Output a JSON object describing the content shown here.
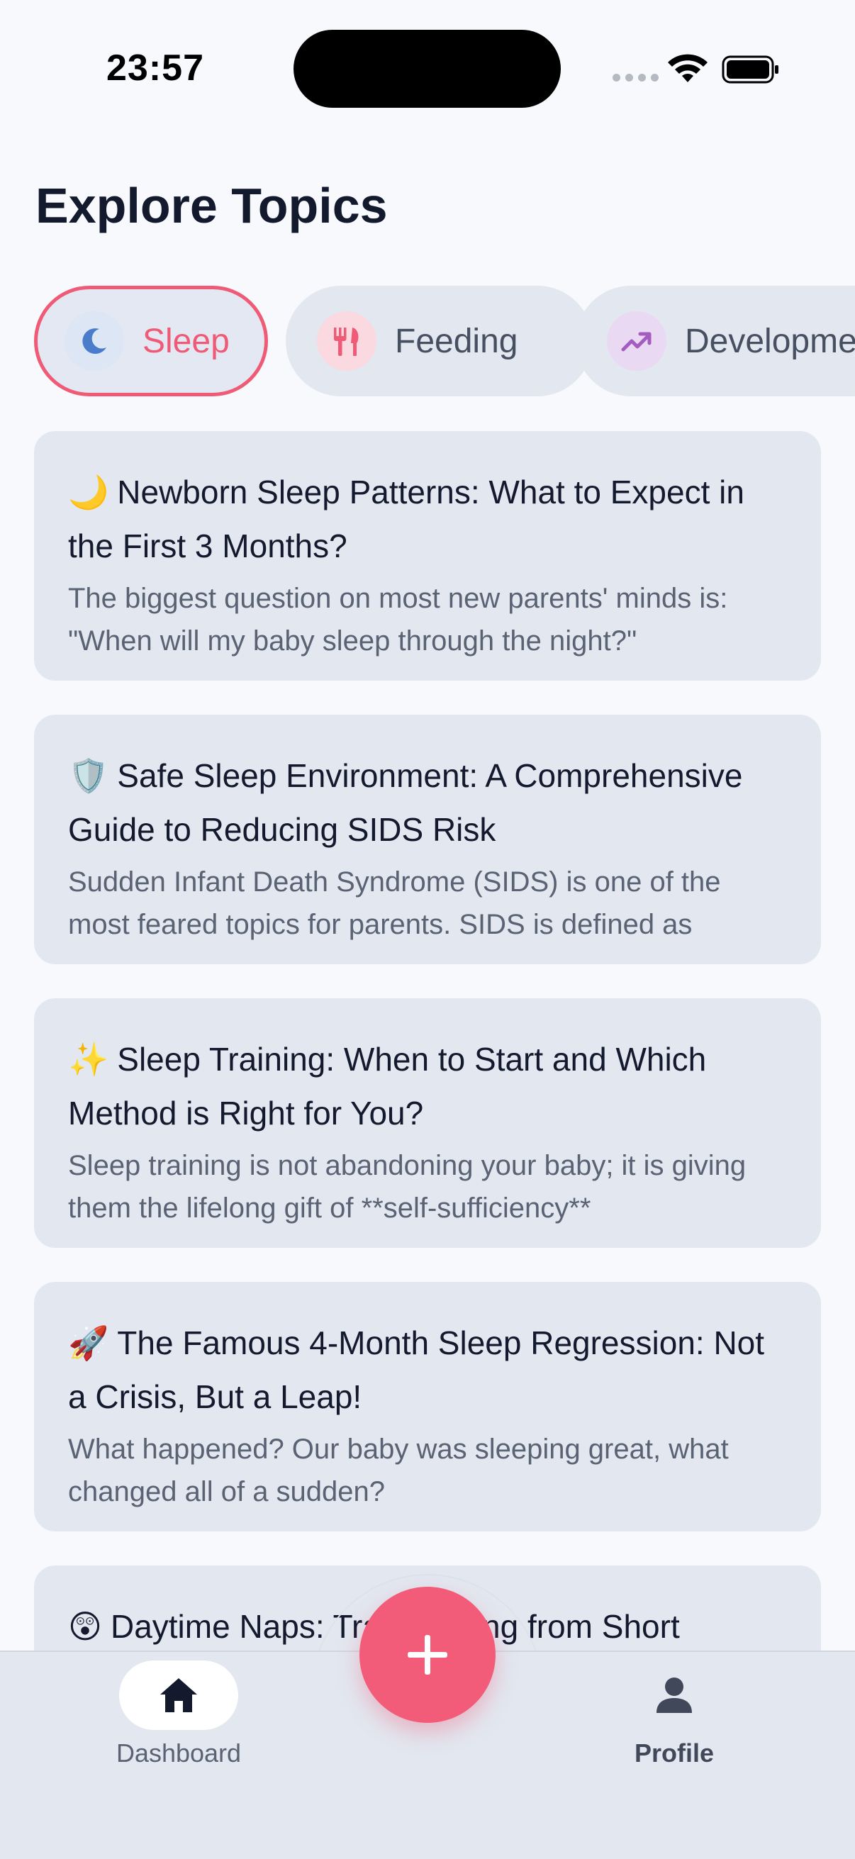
{
  "status_bar": {
    "time": "23:57"
  },
  "page": {
    "title": "Explore Topics"
  },
  "categories": [
    {
      "label": "Sleep",
      "icon": "moon-icon",
      "active": true,
      "icon_bg": "#dde6f4",
      "icon_color": "#4a7ccb"
    },
    {
      "label": "Feeding",
      "icon": "utensils-icon",
      "active": false,
      "icon_bg": "#fbd9e0",
      "icon_color": "#ef5a76"
    },
    {
      "label": "Development",
      "icon": "trending-up-icon",
      "active": false,
      "icon_bg": "#ead9f2",
      "icon_color": "#a45cc0"
    }
  ],
  "articles": [
    {
      "emoji": "🌙",
      "title": "Newborn Sleep Patterns: What to Expect in the First 3 Months?",
      "excerpt": "The biggest question on most new parents' minds is: \"When will my baby sleep through the night?\""
    },
    {
      "emoji": "🛡️",
      "title": "Safe Sleep Environment: A Comprehensive Guide to Reducing SIDS Risk",
      "excerpt": "Sudden Infant Death Syndrome (SIDS) is one of the most feared topics for parents. SIDS is defined as"
    },
    {
      "emoji": "✨",
      "title": "Sleep Training: When to Start and Which Method is Right for You?",
      "excerpt": "Sleep training is not abandoning your baby; it is giving them the lifelong gift of **self-sufficiency**"
    },
    {
      "emoji": "🚀",
      "title": "The Famous 4-Month Sleep Regression: Not a Crisis, But a Leap!",
      "excerpt": "What happened? Our baby was sleeping great, what changed all of a sudden?"
    },
    {
      "emoji": "😲",
      "title": "Daytime Naps: Transitioning from Short",
      "excerpt": ""
    }
  ],
  "bottom_nav": {
    "dashboard_label": "Dashboard",
    "profile_label": "Profile",
    "fab_label": "+"
  },
  "colors": {
    "accent": "#f25c78",
    "background": "#f7f9fc",
    "card": "#e2e7f0",
    "text_primary": "#131a2e",
    "text_secondary": "#5a6373"
  }
}
